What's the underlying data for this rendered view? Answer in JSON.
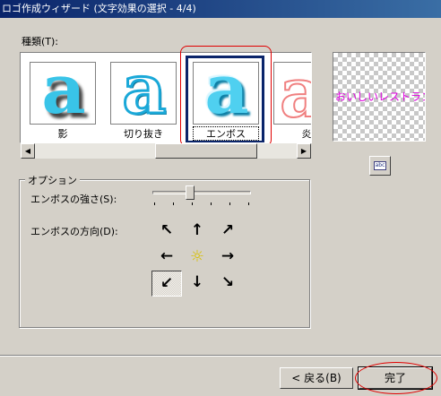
{
  "window": {
    "title": "ロゴ作成ウィザード (文字効果の選択 - 4/4)"
  },
  "effects": {
    "label": "種類(T):",
    "tiles": [
      {
        "glyph": "a",
        "label": "影"
      },
      {
        "glyph": "a",
        "label": "切り抜き"
      },
      {
        "glyph": "a",
        "label": "エンボス",
        "selected": true
      },
      {
        "glyph": "a",
        "label": "炎"
      }
    ],
    "scroll_left": "◀",
    "scroll_right": "▶"
  },
  "preview": {
    "text": "おいしいレストラン",
    "text_color": "#e000e0",
    "font_button_icon": "abc"
  },
  "options": {
    "group_label": "オプション",
    "strength_label": "エンボスの強さ(S):",
    "strength_value": 0.4,
    "direction_label": "エンボスの方向(D):",
    "directions": [
      {
        "icon": "arrow-up-left-icon",
        "glyph": "↖",
        "pressed": false
      },
      {
        "icon": "arrow-up-icon",
        "glyph": "↑",
        "pressed": false
      },
      {
        "icon": "arrow-up-right-icon",
        "glyph": "↗",
        "pressed": false
      },
      {
        "icon": "arrow-left-icon",
        "glyph": "←",
        "pressed": false
      },
      {
        "icon": "sun-icon",
        "glyph": "☼",
        "pressed": false
      },
      {
        "icon": "arrow-right-icon",
        "glyph": "→",
        "pressed": false
      },
      {
        "icon": "arrow-down-left-icon",
        "glyph": "↙",
        "pressed": true
      },
      {
        "icon": "arrow-down-icon",
        "glyph": "↓",
        "pressed": false
      },
      {
        "icon": "arrow-down-right-icon",
        "glyph": "↘",
        "pressed": false
      }
    ]
  },
  "buttons": {
    "back": "< 戻る(B)",
    "finish": "完了"
  },
  "colors": {
    "dialog_bg": "#d4d0c8",
    "title_start": "#0a246a",
    "title_end": "#3a6ea5",
    "annotation_red": "#e00000",
    "glyph_cyan": "#39c4e8"
  }
}
